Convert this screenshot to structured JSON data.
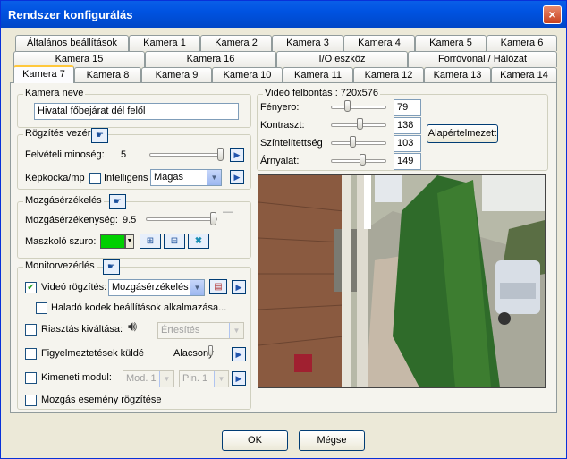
{
  "window": {
    "title": "Rendszer konfigurálás",
    "close_glyph": "×"
  },
  "tabs": {
    "row1": [
      "Általános beállítások",
      "Kamera 1",
      "Kamera 2",
      "Kamera 3",
      "Kamera 4",
      "Kamera 5",
      "Kamera 6"
    ],
    "row2": [
      "Kamera 15",
      "Kamera 16",
      "I/O eszköz",
      "Forróvonal / Hálózat"
    ],
    "row3": [
      "Kamera 7",
      "Kamera 8",
      "Kamera 9",
      "Kamera 10",
      "Kamera 11",
      "Kamera 12",
      "Kamera 13",
      "Kamera 14"
    ],
    "active": "Kamera 7"
  },
  "camera_name": {
    "caption": "Kamera neve",
    "value": "Hivatal főbejárat dél felől"
  },
  "recording": {
    "caption": "Rögzítés vezérl",
    "quality_label": "Felvételi minoség:",
    "quality_value": "5",
    "quality_level": 1.0,
    "fps_label": "Képkocka/mp",
    "intelligent_label": "Intelligens",
    "intelligent_checked": false,
    "fps_select": "Magas"
  },
  "motion": {
    "caption": "Mozgásérzékelés",
    "sensitivity_label": "Mozgásérzékenység:",
    "sensitivity_value": "9.5",
    "sensitivity_level": 0.95,
    "mask_label": "Maszkoló szuro:",
    "mask_color": "#00d000"
  },
  "monitor": {
    "caption": "Monitorvezérlés",
    "video_rec_label": "Videó rögzítés:",
    "video_rec_checked": true,
    "video_rec_select": "Mozgásérzékelés",
    "advanced_codec_label": "Haladó kodek beállítások alkalmazása...",
    "alarm_label": "Riasztás kiváltása:",
    "alarm_select": "Értesítés",
    "warning_label": "Figyelmeztetések küldé",
    "warning_level_label": "Alacsony",
    "output_label": "Kimeneti modul:",
    "output_module_select": "Mod. 1",
    "output_pin_select": "Pin. 1",
    "motion_event_label": "Mozgás esemény rögzítése"
  },
  "video": {
    "caption": "Videó felbontás : 720x576",
    "brightness_label": "Fényero:",
    "brightness_value": "79",
    "brightness_level": 0.31,
    "contrast_label": "Kontraszt:",
    "contrast_value": "138",
    "contrast_level": 0.54,
    "saturation_label": "Színtelítettség",
    "saturation_value": "103",
    "saturation_level": 0.4,
    "hue_label": "Árnyalat:",
    "hue_value": "149",
    "hue_level": 0.58,
    "default_button": "Alapértelmezett"
  },
  "buttons": {
    "ok": "OK",
    "cancel": "Mégse"
  }
}
